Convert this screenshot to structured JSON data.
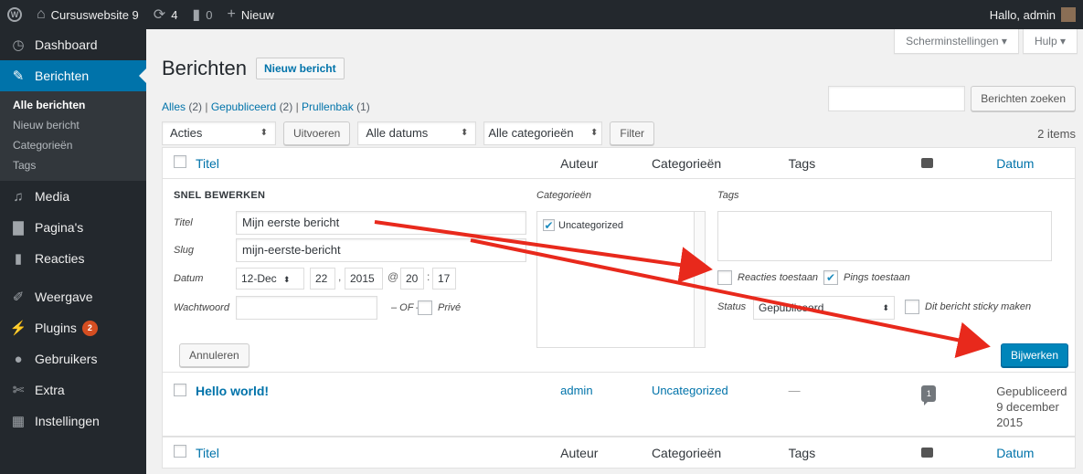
{
  "adminbar": {
    "wp_logo": "wordpress-logo-icon",
    "site_name": "Cursuswebsite 9",
    "updates_count": "4",
    "comments_count": "0",
    "new_label": "Nieuw",
    "greeting": "Hallo, admin"
  },
  "sidebar": {
    "dashboard": "Dashboard",
    "posts": "Berichten",
    "sub": [
      "Alle berichten",
      "Nieuw bericht",
      "Categorieën",
      "Tags"
    ],
    "media": "Media",
    "pages": "Pagina's",
    "comments": "Reacties",
    "appearance": "Weergave",
    "plugins": "Plugins",
    "plugins_badge": "2",
    "users": "Gebruikers",
    "tools": "Extra",
    "settings": "Instellingen"
  },
  "screen": {
    "options": "Scherminstellingen",
    "help": "Hulp"
  },
  "page": {
    "title": "Berichten",
    "add_new": "Nieuw bericht"
  },
  "views": {
    "all": "Alles",
    "all_count": "(2)",
    "published": "Gepubliceerd",
    "published_count": "(2)",
    "trash": "Prullenbak",
    "trash_count": "(1)"
  },
  "search": {
    "value": "",
    "button": "Berichten zoeken"
  },
  "tablenav": {
    "bulk_action": "Acties",
    "apply": "Uitvoeren",
    "dates": "Alle datums",
    "categories": "Alle categorieën",
    "filter": "Filter",
    "items": "2 items"
  },
  "columns": {
    "title": "Titel",
    "author": "Auteur",
    "categories": "Categorieën",
    "tags": "Tags",
    "date": "Datum"
  },
  "quick_edit": {
    "legend": "SNEL BEWERKEN",
    "title_label": "Titel",
    "title_value": "Mijn eerste bericht",
    "slug_label": "Slug",
    "slug_value": "mijn-eerste-bericht",
    "date_label": "Datum",
    "month": "12-Dec",
    "day": "22",
    "year": "2015",
    "at": "@",
    "hour": "20",
    "colon": ":",
    "minute": "17",
    "comma": ",",
    "password_label": "Wachtwoord",
    "password_value": "",
    "or_sep": "– OF –",
    "private_label": "Privé",
    "categories_label": "Categorieën",
    "category_uncategorized": "Uncategorized",
    "tags_label": "Tags",
    "tags_value": "",
    "allow_comments": "Reacties toestaan",
    "allow_pings": "Pings toestaan",
    "status_label": "Status",
    "status_value": "Gepubliceerd",
    "sticky_label": "Dit bericht sticky maken",
    "cancel": "Annuleren",
    "update": "Bijwerken"
  },
  "rows": [
    {
      "title": "Hello world!",
      "author": "admin",
      "category": "Uncategorized",
      "tags": "—",
      "comments": "1",
      "date_status": "Gepubliceerd",
      "date_line1": "9 december",
      "date_line2": "2015"
    }
  ]
}
